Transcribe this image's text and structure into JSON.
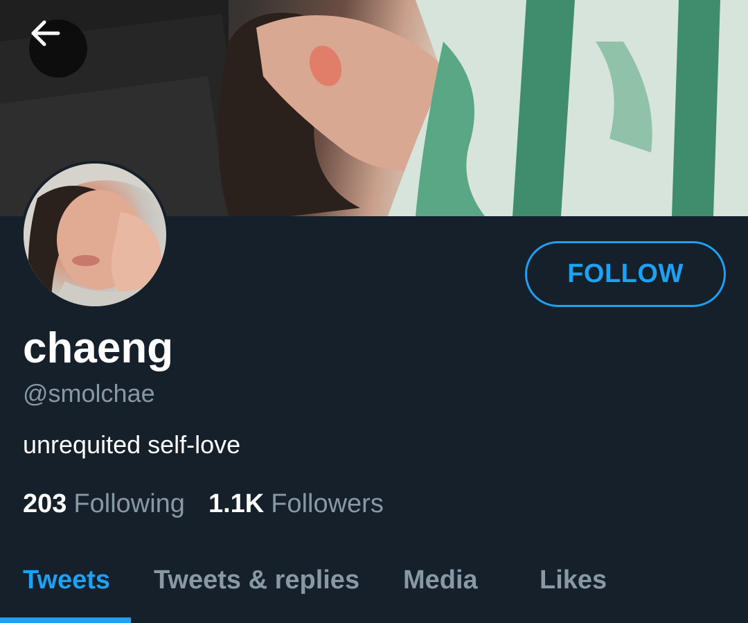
{
  "header": {
    "back_icon": "arrow-left-icon"
  },
  "profile": {
    "display_name": "chaeng",
    "handle": "@smolchae",
    "bio": "unrequited self-love",
    "follow_label": "FOLLOW"
  },
  "stats": {
    "following_count": "203",
    "following_label": "Following",
    "followers_count": "1.1K",
    "followers_label": "Followers"
  },
  "tabs": [
    {
      "label": "Tweets",
      "active": true
    },
    {
      "label": "Tweets & replies",
      "active": false
    },
    {
      "label": "Media",
      "active": false
    },
    {
      "label": "Likes",
      "active": false
    }
  ],
  "colors": {
    "background": "#15202b",
    "accent": "#1da1f2",
    "secondary_text": "#8899a6",
    "primary_text": "#ffffff"
  }
}
